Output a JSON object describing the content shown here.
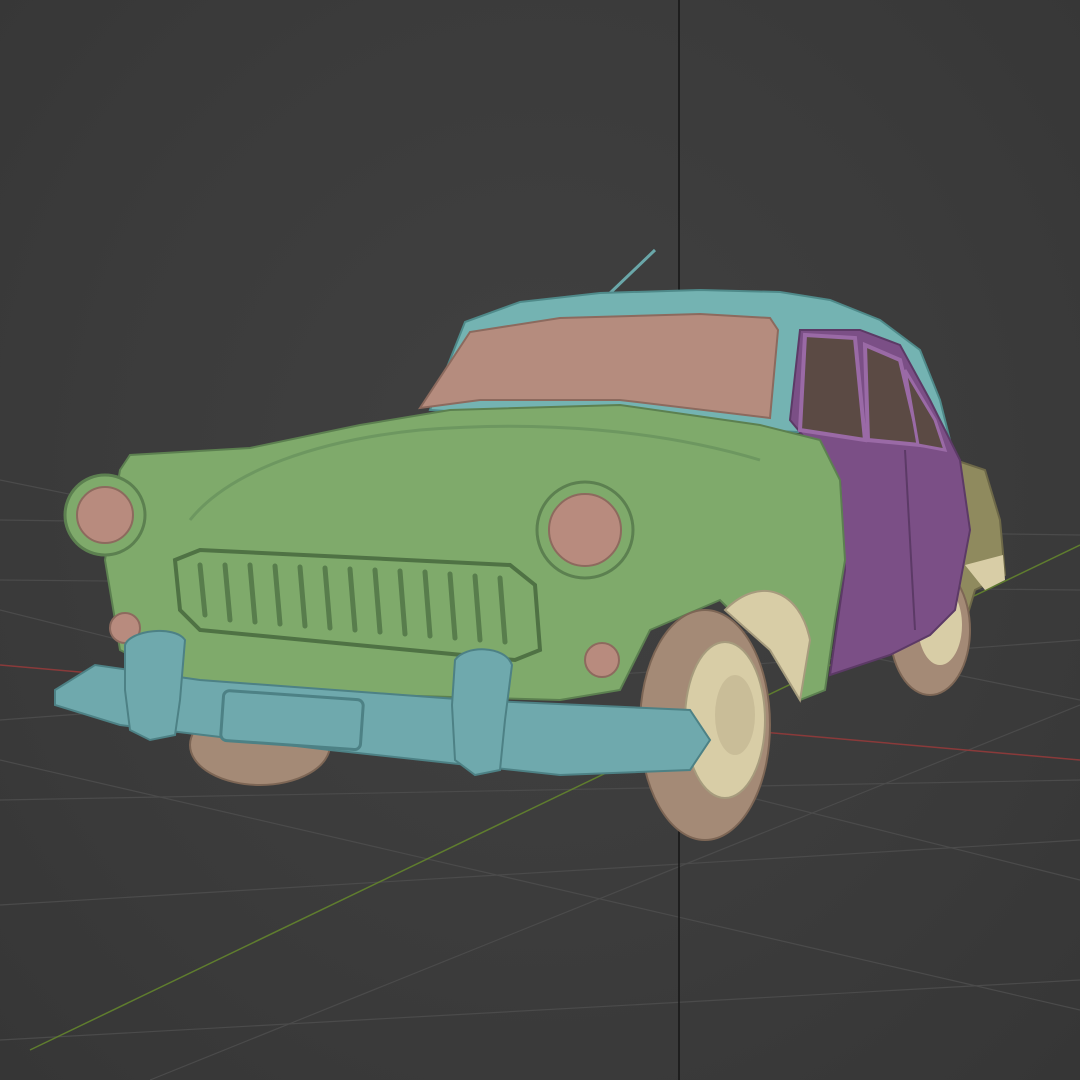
{
  "viewport": {
    "mode": "3d-viewport",
    "shading": "solid",
    "object_view": "car-model",
    "colors": {
      "background": "#3d3d3d",
      "grid_line": "#4a4a4a",
      "x_axis": "#8a3a3a",
      "y_axis": "#5f7d2e",
      "z_axis": "#1a1a1a",
      "body_green": "#7faa6b",
      "roof_teal": "#74b3b2",
      "windshield_pink": "#b58c7e",
      "door_purple": "#7b4f86",
      "bumper_teal": "#6fa9ad",
      "headlight_pink": "#b88b7e",
      "tire_tan": "#a48a76",
      "hubcap_cream": "#d8cda6",
      "rear_olive": "#8f8a5e"
    }
  }
}
